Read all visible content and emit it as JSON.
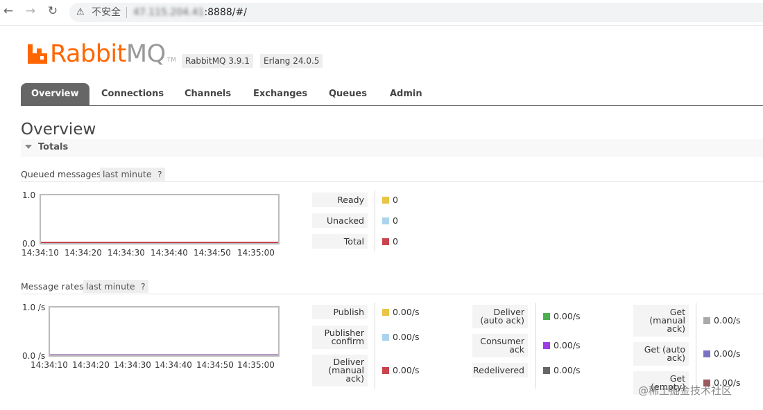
{
  "browser": {
    "insecure_label": "不安全",
    "url_hidden": "47.115.204.41",
    "url_visible": ":8888/#/"
  },
  "logo": {
    "text_orange": "Rabbit",
    "text_grey": "MQ",
    "tm": "TM"
  },
  "versions": [
    "RabbitMQ 3.9.1",
    "Erlang 24.0.5"
  ],
  "tabs": [
    "Overview",
    "Connections",
    "Channels",
    "Exchanges",
    "Queues",
    "Admin"
  ],
  "page_title": "Overview",
  "section": "Totals",
  "queued": {
    "label": "Queued messages",
    "range": "last minute",
    "help": "?",
    "y_max": "1.0",
    "y_min": "0.0",
    "x_ticks": [
      "14:34:10",
      "14:34:20",
      "14:34:30",
      "14:34:40",
      "14:34:50",
      "14:35:00"
    ],
    "legend": [
      {
        "label": "Ready",
        "value": "0",
        "color": "#e8c547"
      },
      {
        "label": "Unacked",
        "value": "0",
        "color": "#aad4ee"
      },
      {
        "label": "Total",
        "value": "0",
        "color": "#c9444d"
      }
    ]
  },
  "rates": {
    "label": "Message rates",
    "range": "last minute",
    "help": "?",
    "y_max": "1.0 /s",
    "y_min": "0.0 /s",
    "x_ticks": [
      "14:34:10",
      "14:34:20",
      "14:34:30",
      "14:34:40",
      "14:34:50",
      "14:35:00"
    ],
    "col1": [
      {
        "label": "Publish",
        "value": "0.00/s",
        "color": "#e8c547"
      },
      {
        "label": "Publisher confirm",
        "value": "0.00/s",
        "color": "#aad4ee"
      },
      {
        "label": "Deliver (manual ack)",
        "value": "0.00/s",
        "color": "#c9444d"
      }
    ],
    "col2": [
      {
        "label": "Deliver (auto ack)",
        "value": "0.00/s",
        "color": "#4caf50"
      },
      {
        "label": "Consumer ack",
        "value": "0.00/s",
        "color": "#9b3ee6"
      },
      {
        "label": "Redelivered",
        "value": "0.00/s",
        "color": "#666666"
      }
    ],
    "col3": [
      {
        "label": "Get (manual ack)",
        "value": "0.00/s",
        "color": "#aaaaaa"
      },
      {
        "label": "Get (auto ack)",
        "value": "0.00/s",
        "color": "#7a72c2"
      },
      {
        "label": "Get (empty)",
        "value": "0.00/s",
        "color": "#9c5a5f"
      }
    ]
  },
  "watermark": "@稀土掘金技术社区"
}
